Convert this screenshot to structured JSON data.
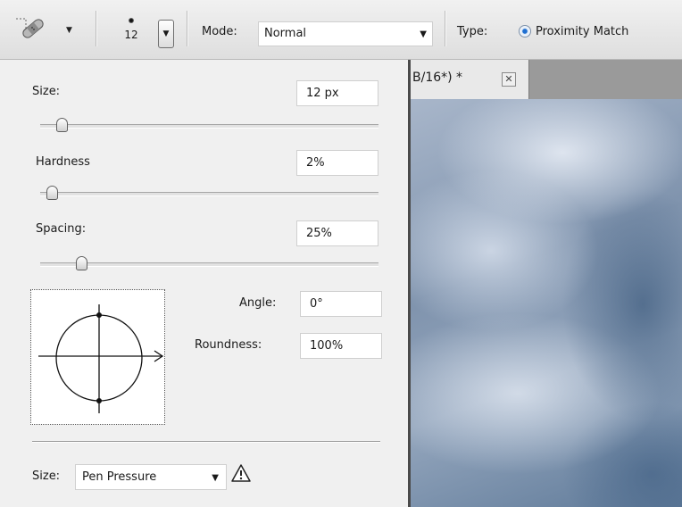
{
  "toolbar": {
    "brush_size_value": "12",
    "mode_label": "Mode:",
    "mode_value": "Normal",
    "type_label": "Type:",
    "type_option": "Proximity Match"
  },
  "brush_panel": {
    "size_label": "Size:",
    "size_value": "12 px",
    "size_fraction": 0.05,
    "hardness_label": "Hardness",
    "hardness_value": "2%",
    "hardness_fraction": 0.02,
    "spacing_label": "Spacing:",
    "spacing_value": "25%",
    "spacing_fraction": 0.11,
    "angle_label": "Angle:",
    "angle_value": "0°",
    "roundness_label": "Roundness:",
    "roundness_value": "100%",
    "pressure_label": "Size:",
    "pressure_value": "Pen Pressure"
  },
  "document": {
    "tab_title": "B/16*) *",
    "close_glyph": "✕"
  },
  "icons": [
    "healing-brush-icon",
    "dropdown-arrow-icon",
    "brush-tip-icon",
    "radio-selected-icon",
    "brush-angle-preview-icon",
    "warning-icon",
    "close-icon"
  ],
  "colors": {
    "panel_bg": "#f0f0f0",
    "radio_accent": "#1f6fd1",
    "sky": "#7f93ad"
  }
}
